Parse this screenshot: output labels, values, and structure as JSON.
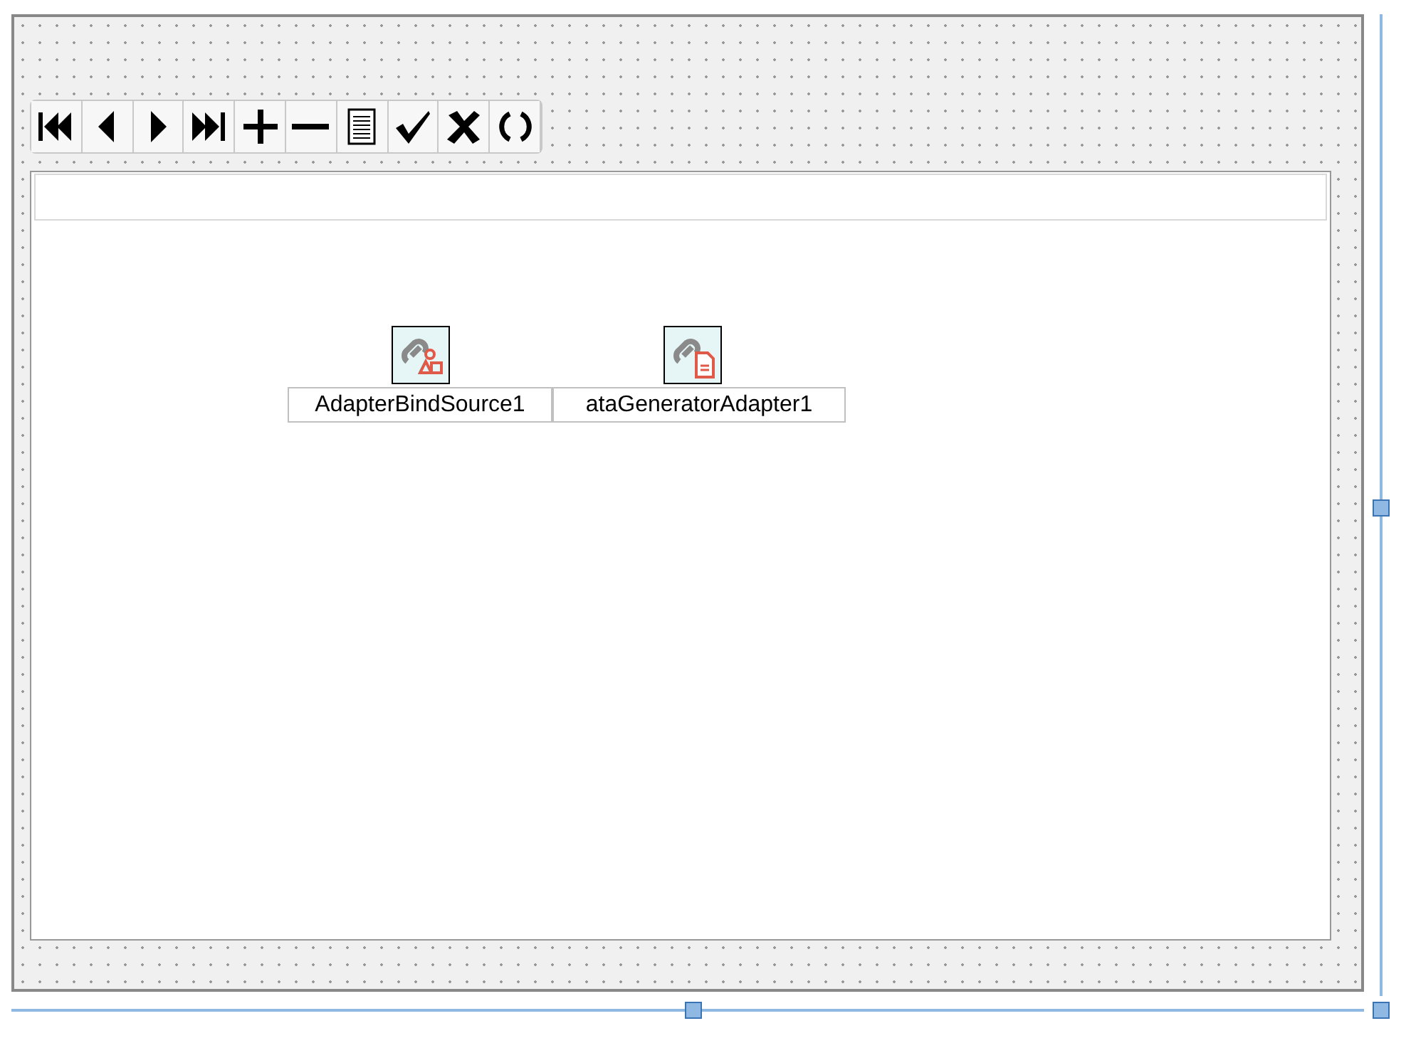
{
  "toolbar": {
    "buttons": [
      {
        "kind": "first"
      },
      {
        "kind": "prev"
      },
      {
        "kind": "next"
      },
      {
        "kind": "last"
      },
      {
        "kind": "add"
      },
      {
        "kind": "remove"
      },
      {
        "kind": "edit"
      },
      {
        "kind": "post"
      },
      {
        "kind": "cancel"
      },
      {
        "kind": "refresh"
      }
    ]
  },
  "components": [
    {
      "kind": "bind-source",
      "label": "AdapterBindSource1"
    },
    {
      "kind": "generator",
      "label": "ataGeneratorAdapter1"
    }
  ]
}
